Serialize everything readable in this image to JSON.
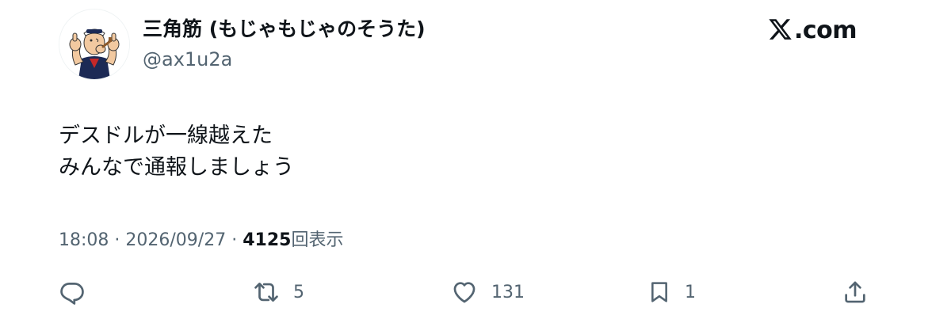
{
  "author": {
    "display_name": "三角筋 (もじゃもじゃのそうた)",
    "handle": "@ax1u2a",
    "avatar_icon": "popeye-avatar-icon"
  },
  "brand": {
    "site": ".com",
    "logo_icon": "x-logo-icon"
  },
  "tweet": {
    "lines": [
      "デスドルが一線越えた",
      "みんなで通報しましょう"
    ],
    "time": "18:08",
    "separator": "·",
    "date": "2026/09/27",
    "views_count": "4125",
    "views_label": "回表示"
  },
  "actions": {
    "reply": {
      "icon": "reply-icon",
      "count": ""
    },
    "retweet": {
      "icon": "retweet-icon",
      "count": "5"
    },
    "like": {
      "icon": "heart-icon",
      "count": "131"
    },
    "bookmark": {
      "icon": "bookmark-icon",
      "count": "1"
    },
    "share": {
      "icon": "share-icon",
      "count": ""
    }
  },
  "colors": {
    "text_primary": "#0f1419",
    "text_secondary": "#536471"
  }
}
